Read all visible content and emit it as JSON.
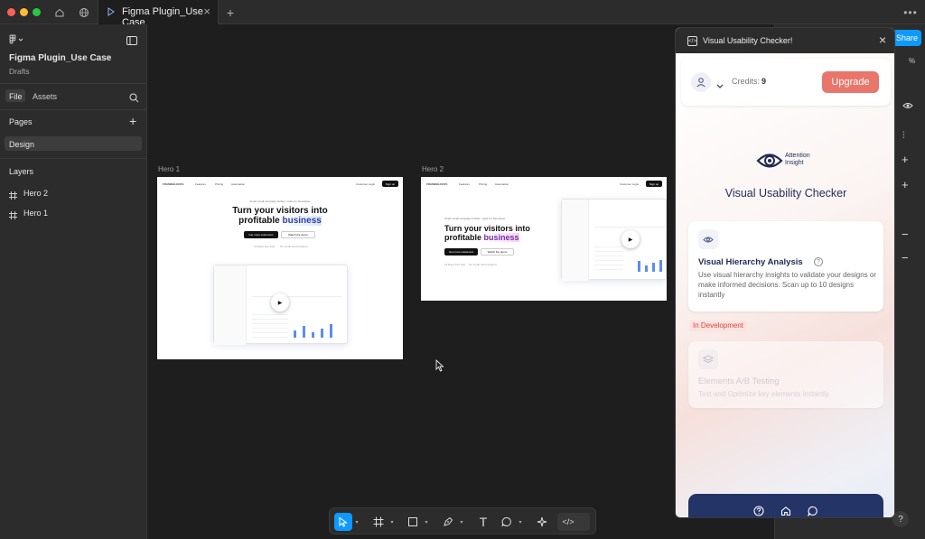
{
  "app": {
    "tab_title": "Figma Plugin_Use Case",
    "share_label": "Share",
    "zoom_frag": "%",
    "help_label": "?"
  },
  "sidebar": {
    "file_name": "Figma Plugin_Use Case",
    "file_location": "Drafts",
    "tabs": [
      {
        "label": "File"
      },
      {
        "label": "Assets"
      }
    ],
    "pages_heading": "Pages",
    "pages": [
      {
        "label": "Design"
      }
    ],
    "layers_heading": "Layers",
    "layers": [
      {
        "label": "Hero 2"
      },
      {
        "label": "Hero 1"
      }
    ]
  },
  "canvas": {
    "frames": [
      {
        "label": "Hero 1",
        "brand": "FRAMEBLOCKS",
        "nav": [
          "Features",
          "Pricing",
          "Automation"
        ],
        "login": "Customer Login",
        "signup": "Sign up",
        "kicker": "Smart small campaign builder, made for Developer",
        "headline_1": "Turn your visitors into",
        "headline_2a": "profitable ",
        "headline_2b": "business",
        "cta_primary": "Get more customers",
        "cta_secondary": "Watch the demo",
        "note_1": "14 Days free trial",
        "note_2": "No credit card required"
      },
      {
        "label": "Hero 2",
        "brand": "FRAMEBLOCKS",
        "nav": [
          "Features",
          "Pricing",
          "Automation"
        ],
        "login": "Customer Login",
        "signup": "Sign up",
        "kicker": "Smart small campaign builder, made for Developer",
        "headline_1": "Turn your visitors into",
        "headline_2a": "profitable ",
        "headline_2b": "business",
        "cta_primary": "Get more customers",
        "cta_secondary": "Watch the demo",
        "note_1": "14 Days free trial",
        "note_2": "No credit card required"
      }
    ]
  },
  "plugin": {
    "window_title": "Visual Usability Checker!",
    "credits_label": "Credits:",
    "credits_value": "9",
    "upgrade_label": "Upgrade",
    "brand_line_1": "Attention",
    "brand_line_2": "Insight",
    "title": "Visual Usability Checker",
    "feature_1": {
      "title": "Visual Hierarchy Analysis",
      "description": "Use visual hierarchy insights to validate your designs or make informed decisions. Scan up to 10 designs instantly"
    },
    "badge": "In Development",
    "feature_2": {
      "title": "Elements A/B Testing",
      "description": "Test and Optimize key elements instantly"
    },
    "colors": {
      "accent": "#e8766b",
      "nav_bg": "#253466",
      "badge_bg": "#fde2e0",
      "badge_text": "#d14a40"
    }
  }
}
